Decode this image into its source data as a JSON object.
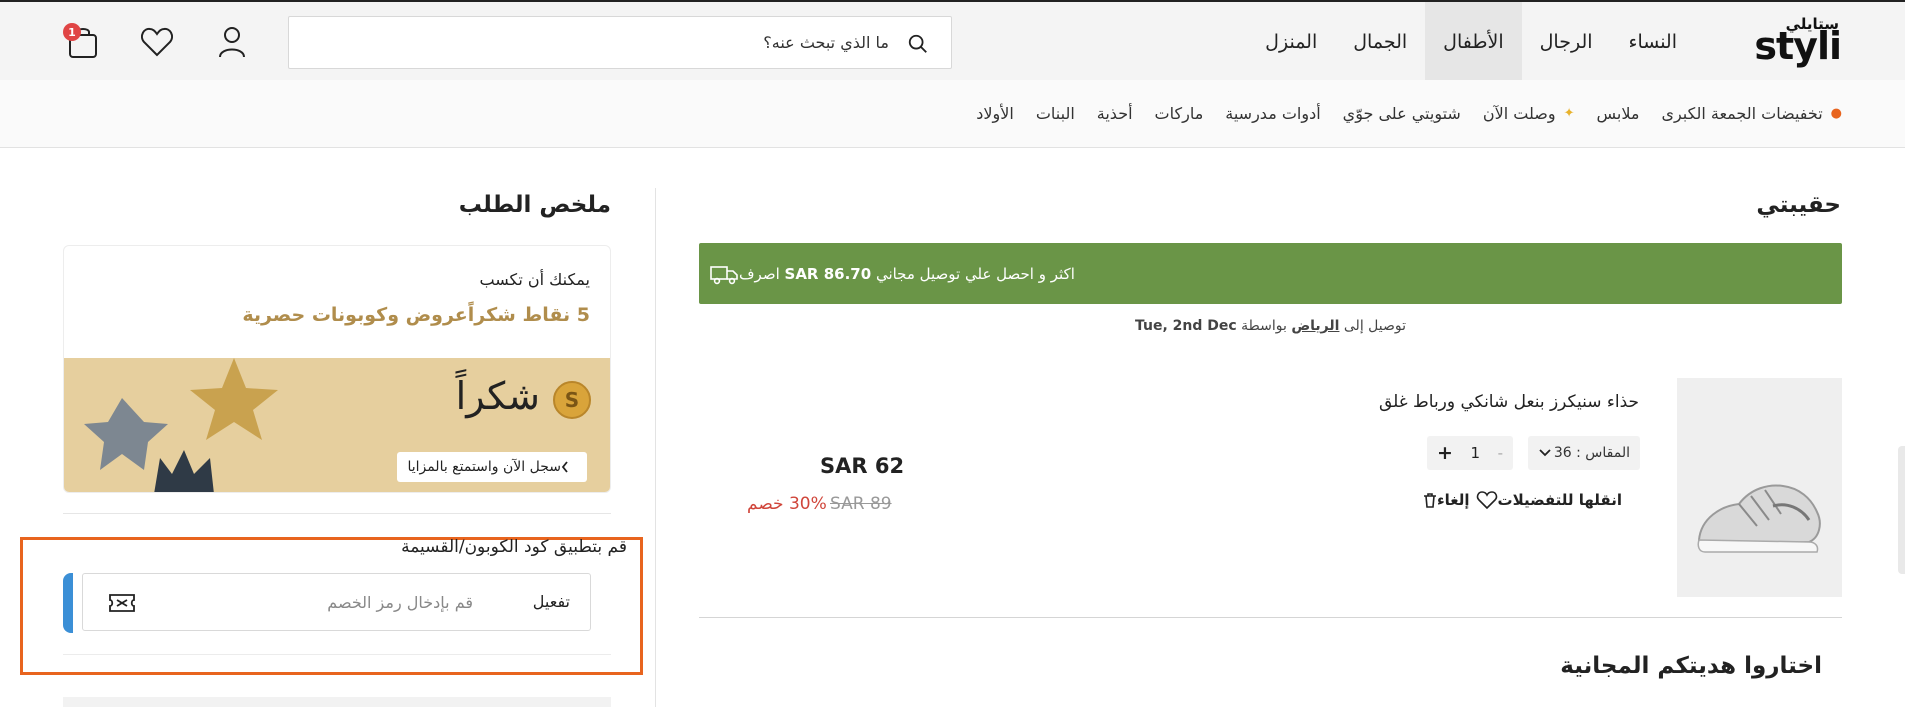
{
  "header": {
    "logo_ar": "ستايلي",
    "logo_en": "styli",
    "nav": [
      "النساء",
      "الرجال",
      "الأطفال",
      "الجمال",
      "المنزل"
    ],
    "nav_active": "الأطفال",
    "search_placeholder": "ما الذي تبحث عنه؟",
    "cart_count": "1"
  },
  "subnav": [
    {
      "label": "تخفيضات الجمعة الكبرى",
      "icon": "fire-icon"
    },
    {
      "label": "ملابس",
      "icon": ""
    },
    {
      "label": "وصلت الآن",
      "icon": "sparkle-icon"
    },
    {
      "label": "شتويتي على جوّي",
      "icon": ""
    },
    {
      "label": "أدوات مدرسية",
      "icon": ""
    },
    {
      "label": "ماركات",
      "icon": ""
    },
    {
      "label": "أحذية",
      "icon": ""
    },
    {
      "label": "البنات",
      "icon": ""
    },
    {
      "label": "الأولاد",
      "icon": ""
    }
  ],
  "cart": {
    "title": "حقيبتي",
    "banner": {
      "prefix": "اصرف",
      "amount": "SAR 86.70",
      "suffix": "اكثر و احصل علي توصيل مجاني"
    },
    "delivery": {
      "prefix": "توصيل إلى",
      "city": "الرياض",
      "by": "بواسطة",
      "date": "Tue, 2nd Dec"
    },
    "item": {
      "name": "حذاء سنيكرز بنعل شانكي ورباط غلق",
      "size": "المقاس : 36",
      "qty": "1",
      "plus": "+",
      "minus": "-",
      "remove": "إلغاء",
      "move_to_wishlist": "انقلها للتفضيلات",
      "price": "SAR 62",
      "old_price": "SAR 89",
      "discount": "30% خصم"
    },
    "gift_title": "اختاروا هديتكم المجانية"
  },
  "summary": {
    "title": "ملخص الطلب",
    "earn_label": "يمكنك أن تكسب",
    "earn_value": "5 نقاط شكراًعروض وكوبونات حصرية",
    "thanks": "شكراً",
    "signup_cta": "سجل الآن واستمتع بالمزايا",
    "coupon_label": "قم بتطبيق كود الكوبون/القسيمة",
    "coupon_placeholder": "قم بإدخال رمز الخصم",
    "apply": "تفعيل"
  },
  "colors": {
    "banner_green": "#6a9547",
    "discount_red": "#d0453a",
    "points_gold": "#b08d4c",
    "highlight_orange": "#e8641e",
    "badge_red": "#e04545"
  }
}
